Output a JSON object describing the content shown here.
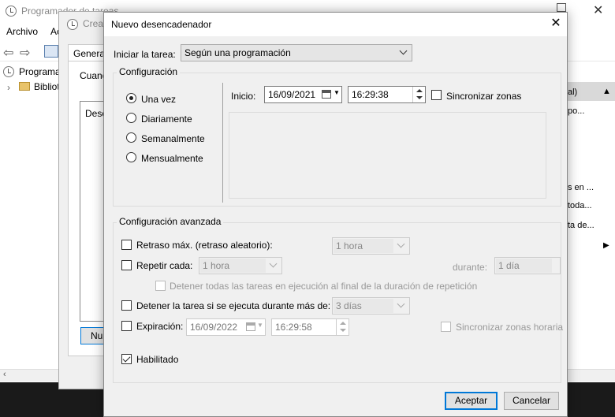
{
  "background": {
    "title": "Programador de tareas",
    "menu": [
      "Archivo",
      "Ac"
    ],
    "tree": [
      "Programa",
      "Bibliot"
    ],
    "actions": [
      "al)",
      "po...",
      "s en ...",
      "toda...",
      "ta de..."
    ]
  },
  "crear_tarea": {
    "title": "Crear",
    "tab": "General",
    "label": "Cuand",
    "list_text": "Desc",
    "button": "Nu"
  },
  "dialog": {
    "title": "Nuevo desencadenador",
    "start_task_label": "Iniciar la tarea:",
    "start_task_value": "Según una programación",
    "config_group": "Configuración",
    "schedule_options": [
      "Una vez",
      "Diariamente",
      "Semanalmente",
      "Mensualmente"
    ],
    "selected_option": "Una vez",
    "start_label": "Inicio:",
    "start_date": "16/09/2021",
    "start_time": "16:29:38",
    "sync_zones": "Sincronizar zonas",
    "advanced_group": "Configuración avanzada",
    "delay_label": "Retraso máx. (retraso aleatorio):",
    "delay_value": "1 hora",
    "repeat_label": "Repetir cada:",
    "repeat_value": "1 hora",
    "duration_label": "durante:",
    "duration_value": "1 día",
    "stop_all_label": "Detener todas las tareas en ejecución al final de la duración de repetición",
    "stop_if_label": "Detener la tarea si se ejecuta durante más de:",
    "stop_if_value": "3 días",
    "expire_label": "Expiración:",
    "expire_date": "16/09/2022",
    "expire_time": "16:29:58",
    "sync_zones_time": "Sincronizar zonas horaria",
    "enabled_label": "Habilitado",
    "ok_button": "Aceptar",
    "cancel_button": "Cancelar"
  },
  "colors": {
    "accent": "#0078d7",
    "dialog_bg": "#f0f0f0",
    "taskbar": "#1a1a1a"
  }
}
